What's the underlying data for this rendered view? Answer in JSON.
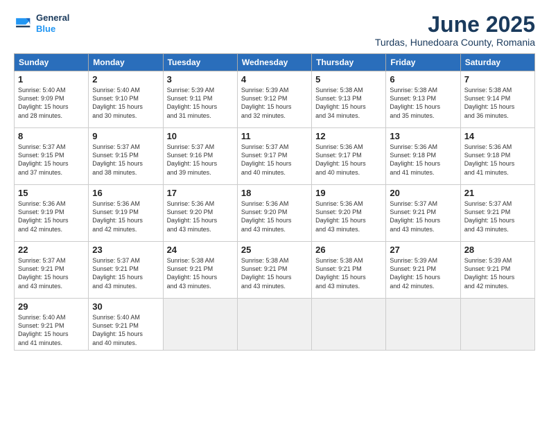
{
  "logo": {
    "line1": "General",
    "line2": "Blue"
  },
  "title": "June 2025",
  "subtitle": "Turdas, Hunedoara County, Romania",
  "days_of_week": [
    "Sunday",
    "Monday",
    "Tuesday",
    "Wednesday",
    "Thursday",
    "Friday",
    "Saturday"
  ],
  "weeks": [
    [
      {
        "day": 1,
        "info": "Sunrise: 5:40 AM\nSunset: 9:09 PM\nDaylight: 15 hours\nand 28 minutes."
      },
      {
        "day": 2,
        "info": "Sunrise: 5:40 AM\nSunset: 9:10 PM\nDaylight: 15 hours\nand 30 minutes."
      },
      {
        "day": 3,
        "info": "Sunrise: 5:39 AM\nSunset: 9:11 PM\nDaylight: 15 hours\nand 31 minutes."
      },
      {
        "day": 4,
        "info": "Sunrise: 5:39 AM\nSunset: 9:12 PM\nDaylight: 15 hours\nand 32 minutes."
      },
      {
        "day": 5,
        "info": "Sunrise: 5:38 AM\nSunset: 9:13 PM\nDaylight: 15 hours\nand 34 minutes."
      },
      {
        "day": 6,
        "info": "Sunrise: 5:38 AM\nSunset: 9:13 PM\nDaylight: 15 hours\nand 35 minutes."
      },
      {
        "day": 7,
        "info": "Sunrise: 5:38 AM\nSunset: 9:14 PM\nDaylight: 15 hours\nand 36 minutes."
      }
    ],
    [
      {
        "day": 8,
        "info": "Sunrise: 5:37 AM\nSunset: 9:15 PM\nDaylight: 15 hours\nand 37 minutes."
      },
      {
        "day": 9,
        "info": "Sunrise: 5:37 AM\nSunset: 9:15 PM\nDaylight: 15 hours\nand 38 minutes."
      },
      {
        "day": 10,
        "info": "Sunrise: 5:37 AM\nSunset: 9:16 PM\nDaylight: 15 hours\nand 39 minutes."
      },
      {
        "day": 11,
        "info": "Sunrise: 5:37 AM\nSunset: 9:17 PM\nDaylight: 15 hours\nand 40 minutes."
      },
      {
        "day": 12,
        "info": "Sunrise: 5:36 AM\nSunset: 9:17 PM\nDaylight: 15 hours\nand 40 minutes."
      },
      {
        "day": 13,
        "info": "Sunrise: 5:36 AM\nSunset: 9:18 PM\nDaylight: 15 hours\nand 41 minutes."
      },
      {
        "day": 14,
        "info": "Sunrise: 5:36 AM\nSunset: 9:18 PM\nDaylight: 15 hours\nand 41 minutes."
      }
    ],
    [
      {
        "day": 15,
        "info": "Sunrise: 5:36 AM\nSunset: 9:19 PM\nDaylight: 15 hours\nand 42 minutes."
      },
      {
        "day": 16,
        "info": "Sunrise: 5:36 AM\nSunset: 9:19 PM\nDaylight: 15 hours\nand 42 minutes."
      },
      {
        "day": 17,
        "info": "Sunrise: 5:36 AM\nSunset: 9:20 PM\nDaylight: 15 hours\nand 43 minutes."
      },
      {
        "day": 18,
        "info": "Sunrise: 5:36 AM\nSunset: 9:20 PM\nDaylight: 15 hours\nand 43 minutes."
      },
      {
        "day": 19,
        "info": "Sunrise: 5:36 AM\nSunset: 9:20 PM\nDaylight: 15 hours\nand 43 minutes."
      },
      {
        "day": 20,
        "info": "Sunrise: 5:37 AM\nSunset: 9:21 PM\nDaylight: 15 hours\nand 43 minutes."
      },
      {
        "day": 21,
        "info": "Sunrise: 5:37 AM\nSunset: 9:21 PM\nDaylight: 15 hours\nand 43 minutes."
      }
    ],
    [
      {
        "day": 22,
        "info": "Sunrise: 5:37 AM\nSunset: 9:21 PM\nDaylight: 15 hours\nand 43 minutes."
      },
      {
        "day": 23,
        "info": "Sunrise: 5:37 AM\nSunset: 9:21 PM\nDaylight: 15 hours\nand 43 minutes."
      },
      {
        "day": 24,
        "info": "Sunrise: 5:38 AM\nSunset: 9:21 PM\nDaylight: 15 hours\nand 43 minutes."
      },
      {
        "day": 25,
        "info": "Sunrise: 5:38 AM\nSunset: 9:21 PM\nDaylight: 15 hours\nand 43 minutes."
      },
      {
        "day": 26,
        "info": "Sunrise: 5:38 AM\nSunset: 9:21 PM\nDaylight: 15 hours\nand 43 minutes."
      },
      {
        "day": 27,
        "info": "Sunrise: 5:39 AM\nSunset: 9:21 PM\nDaylight: 15 hours\nand 42 minutes."
      },
      {
        "day": 28,
        "info": "Sunrise: 5:39 AM\nSunset: 9:21 PM\nDaylight: 15 hours\nand 42 minutes."
      }
    ],
    [
      {
        "day": 29,
        "info": "Sunrise: 5:40 AM\nSunset: 9:21 PM\nDaylight: 15 hours\nand 41 minutes."
      },
      {
        "day": 30,
        "info": "Sunrise: 5:40 AM\nSunset: 9:21 PM\nDaylight: 15 hours\nand 40 minutes."
      },
      {
        "day": null,
        "info": ""
      },
      {
        "day": null,
        "info": ""
      },
      {
        "day": null,
        "info": ""
      },
      {
        "day": null,
        "info": ""
      },
      {
        "day": null,
        "info": ""
      }
    ]
  ]
}
